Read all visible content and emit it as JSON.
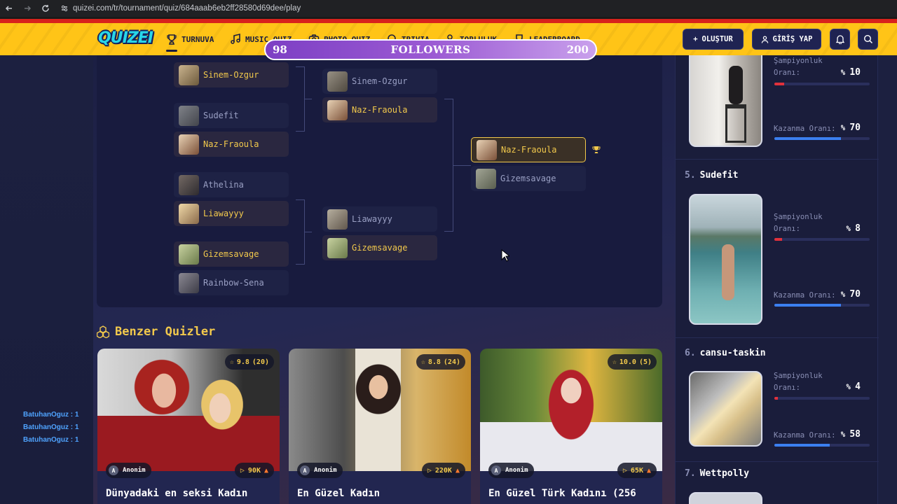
{
  "browser": {
    "url": "quizei.com/tr/tournament/quiz/684aaab6eb2ff28580d69dee/play"
  },
  "header": {
    "logo": "QUIZEI",
    "nav": [
      {
        "label": "TURNUVA",
        "icon": "trophy-icon",
        "active": true
      },
      {
        "label": "MUSIC QUIZ",
        "icon": "music-icon"
      },
      {
        "label": "PHOTO QUIZ",
        "icon": "camera-icon"
      },
      {
        "label": "TRIVIA",
        "icon": "lightbulb-icon"
      },
      {
        "label": "TOPLULUK",
        "icon": "users-icon"
      },
      {
        "label": "LEADERBOARD",
        "icon": "trophy-icon"
      }
    ],
    "create_label": "OLUŞTUR",
    "login_label": "GİRİŞ YAP"
  },
  "followers": {
    "current": "98",
    "label": "FOLLOWERS",
    "goal": "200",
    "progress": 0.49
  },
  "gift_feed": [
    "BatuhanOguz : 1",
    "BatuhanOguz : 1",
    "BatuhanOguz : 1"
  ],
  "bracket": {
    "round1": [
      "Sinem-Ozgur",
      "Sudefit",
      "Naz-Fraoula",
      "Athelina",
      "Liawayyy",
      "Gizemsavage",
      "Rainbow-Sena"
    ],
    "round2": [
      "Sinem-Ozgur",
      "Naz-Fraoula",
      "Liawayyy",
      "Gizemsavage"
    ],
    "final": [
      "Naz-Fraoula",
      "Gizemsavage"
    ]
  },
  "similar": {
    "title": "Benzer Quizler",
    "cards": [
      {
        "rating": "9.8",
        "votes": "(20)",
        "author": "Anonim",
        "plays": "90K",
        "title": "Dünyadaki en seksi Kadın"
      },
      {
        "rating": "8.8",
        "votes": "(24)",
        "author": "Anonim",
        "plays": "220K",
        "title": "En Güzel Kadın"
      },
      {
        "rating": "10.0",
        "votes": "(5)",
        "author": "Anonim",
        "plays": "65K",
        "title": "En Güzel Türk Kadını (256"
      }
    ]
  },
  "leaderboard": {
    "champ_label": "Şampiyonluk",
    "champ_label2": "Oranı:",
    "win_label": "Kazanma Oranı:",
    "pct": "%",
    "entries": [
      {
        "rank": "",
        "name": "",
        "champ": "10",
        "win": "70",
        "champ_frac": 0.1,
        "win_frac": 0.7
      },
      {
        "rank": "5.",
        "name": "Sudefit",
        "champ": "8",
        "win": "70",
        "champ_frac": 0.08,
        "win_frac": 0.7
      },
      {
        "rank": "6.",
        "name": "cansu-taskin",
        "champ": "4",
        "win": "58",
        "champ_frac": 0.04,
        "win_frac": 0.58
      },
      {
        "rank": "7.",
        "name": "Wettpolly"
      }
    ]
  },
  "colors": {
    "accent": "#f2c94c",
    "header": "#ffc417",
    "champ_bar": "#e0313c",
    "win_bar": "#3b7ff0"
  }
}
